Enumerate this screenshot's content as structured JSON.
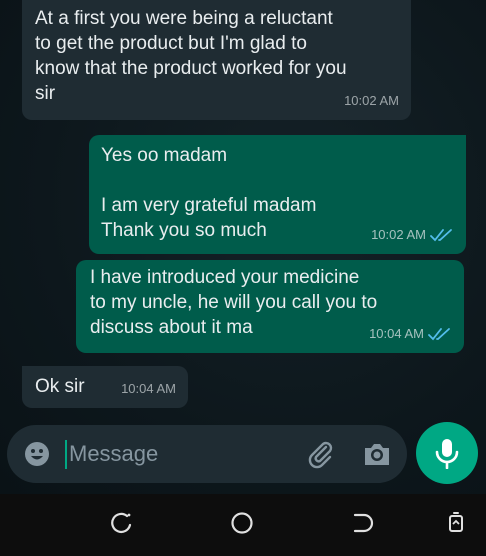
{
  "messages": [
    {
      "direction": "incoming",
      "text": "At a first you were being a reluctant\nto get the product but I'm glad to\nknow that the product worked for you\nsir",
      "time": "10:02 AM"
    },
    {
      "direction": "outgoing",
      "text": "Yes oo madam\n\nI am very grateful madam\nThank you so much",
      "time": "10:02 AM",
      "status": "read"
    },
    {
      "direction": "outgoing",
      "text": "I have introduced your medicine\nto my uncle, he will you call you to\ndiscuss about it ma",
      "time": "10:04 AM",
      "status": "read"
    },
    {
      "direction": "incoming",
      "text": "Ok sir",
      "time": "10:04 AM"
    }
  ],
  "composer": {
    "placeholder": "Message",
    "icons": [
      "emoji-icon",
      "attach-icon",
      "camera-icon",
      "mic-icon"
    ]
  },
  "navbar": {
    "icons": [
      "recent-apps-icon",
      "home-icon",
      "back-icon",
      "rotate-icon"
    ]
  },
  "colors": {
    "accent": "#00a884",
    "incoming_bubble": "#1f2c33",
    "outgoing_bubble": "#005c4b",
    "read_ticks": "#53bdeb"
  }
}
